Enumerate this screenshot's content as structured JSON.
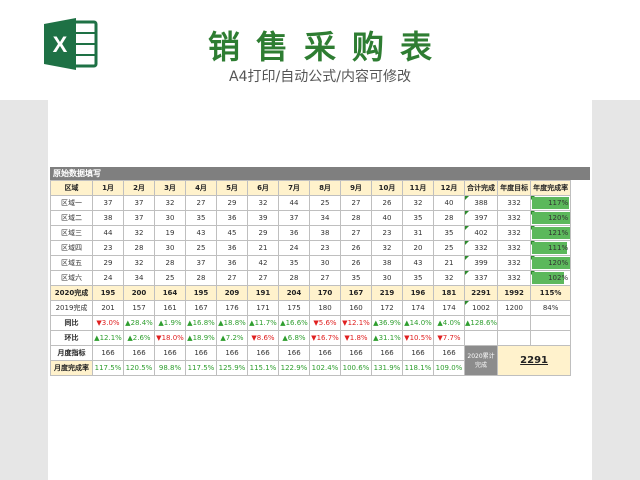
{
  "header": {
    "title": "销售采购表",
    "subtitle": "A4打印/自动公式/内容可修改",
    "logo_letter": "X",
    "accent": "#1e7145"
  },
  "section_title": "原始数据填写",
  "columns": [
    "区域",
    "1月",
    "2月",
    "3月",
    "4月",
    "5月",
    "6月",
    "7月",
    "8月",
    "9月",
    "10月",
    "11月",
    "12月",
    "合计完成",
    "年度目标",
    "年度完成率"
  ],
  "regions": [
    {
      "name": "区域一",
      "months": [
        "37",
        "37",
        "32",
        "27",
        "29",
        "32",
        "44",
        "25",
        "27",
        "26",
        "32",
        "40"
      ],
      "total": "388",
      "target": "332",
      "rate": "117%",
      "rate_value": 1.17
    },
    {
      "name": "区域二",
      "months": [
        "38",
        "37",
        "30",
        "35",
        "36",
        "39",
        "37",
        "34",
        "28",
        "40",
        "35",
        "28"
      ],
      "total": "397",
      "target": "332",
      "rate": "120%",
      "rate_value": 1.2
    },
    {
      "name": "区域三",
      "months": [
        "44",
        "32",
        "19",
        "43",
        "45",
        "29",
        "36",
        "38",
        "27",
        "23",
        "31",
        "35"
      ],
      "total": "402",
      "target": "332",
      "rate": "121%",
      "rate_value": 1.21
    },
    {
      "name": "区域四",
      "months": [
        "23",
        "28",
        "30",
        "25",
        "36",
        "21",
        "24",
        "23",
        "26",
        "32",
        "20",
        "25"
      ],
      "total": "332",
      "target": "332",
      "rate": "111%",
      "rate_value": 1.11
    },
    {
      "name": "区域五",
      "months": [
        "29",
        "32",
        "28",
        "37",
        "36",
        "42",
        "35",
        "30",
        "26",
        "38",
        "43",
        "21"
      ],
      "total": "399",
      "target": "332",
      "rate": "120%",
      "rate_value": 1.2
    },
    {
      "name": "区域六",
      "months": [
        "24",
        "34",
        "25",
        "28",
        "27",
        "27",
        "28",
        "27",
        "35",
        "30",
        "35",
        "32"
      ],
      "total": "337",
      "target": "332",
      "rate": "102%",
      "rate_value": 1.02
    }
  ],
  "total2020": {
    "label": "2020完成",
    "months": [
      "195",
      "200",
      "164",
      "195",
      "209",
      "191",
      "204",
      "170",
      "167",
      "219",
      "196",
      "181"
    ],
    "total": "2291",
    "target": "1992",
    "rate": "115%"
  },
  "total2019": {
    "label": "2019完成",
    "months": [
      "201",
      "157",
      "161",
      "167",
      "176",
      "171",
      "175",
      "180",
      "160",
      "172",
      "174",
      "174"
    ],
    "total": "1002",
    "target": "1200",
    "rate": "84%"
  },
  "yoy": {
    "label": "同比",
    "items": [
      {
        "dir": "down",
        "text": "3.0%"
      },
      {
        "dir": "up",
        "text": "28.4%"
      },
      {
        "dir": "up",
        "text": "1.9%"
      },
      {
        "dir": "up",
        "text": "16.8%"
      },
      {
        "dir": "up",
        "text": "18.8%"
      },
      {
        "dir": "up",
        "text": "11.7%"
      },
      {
        "dir": "up",
        "text": "16.6%"
      },
      {
        "dir": "down",
        "text": "5.6%"
      },
      {
        "dir": "down",
        "text": "12.1%"
      },
      {
        "dir": "up",
        "text": "36.9%"
      },
      {
        "dir": "up",
        "text": "14.0%"
      },
      {
        "dir": "up",
        "text": "4.0%"
      }
    ],
    "extra": {
      "dir": "up",
      "text": "128.6%"
    }
  },
  "mom": {
    "label": "环比",
    "items": [
      {
        "dir": "up",
        "text": "12.1%"
      },
      {
        "dir": "up",
        "text": "2.6%"
      },
      {
        "dir": "down",
        "text": "18.0%"
      },
      {
        "dir": "up",
        "text": "18.9%"
      },
      {
        "dir": "up",
        "text": "7.2%"
      },
      {
        "dir": "down",
        "text": "8.6%"
      },
      {
        "dir": "up",
        "text": "6.8%"
      },
      {
        "dir": "down",
        "text": "16.7%"
      },
      {
        "dir": "down",
        "text": "1.8%"
      },
      {
        "dir": "up",
        "text": "31.1%"
      },
      {
        "dir": "down",
        "text": "10.5%"
      },
      {
        "dir": "down",
        "text": "7.7%"
      }
    ]
  },
  "monthly_target": {
    "label": "月度指标",
    "months": [
      "166",
      "166",
      "166",
      "166",
      "166",
      "166",
      "166",
      "166",
      "166",
      "166",
      "166",
      "166"
    ]
  },
  "monthly_rate": {
    "label": "月度完成率",
    "months": [
      "117.5%",
      "120.5%",
      "98.8%",
      "117.5%",
      "125.9%",
      "115.1%",
      "122.9%",
      "102.4%",
      "100.6%",
      "131.9%",
      "118.1%",
      "109.0%"
    ]
  },
  "cumulative": {
    "label": "2020累计完成",
    "value": "2291"
  },
  "colors": {
    "green_text": "#2e9e2e",
    "red_text": "#e02020",
    "bar": "#5cb85c",
    "header_bg": "#fff2cc",
    "section_bg": "#7f7f7f"
  }
}
